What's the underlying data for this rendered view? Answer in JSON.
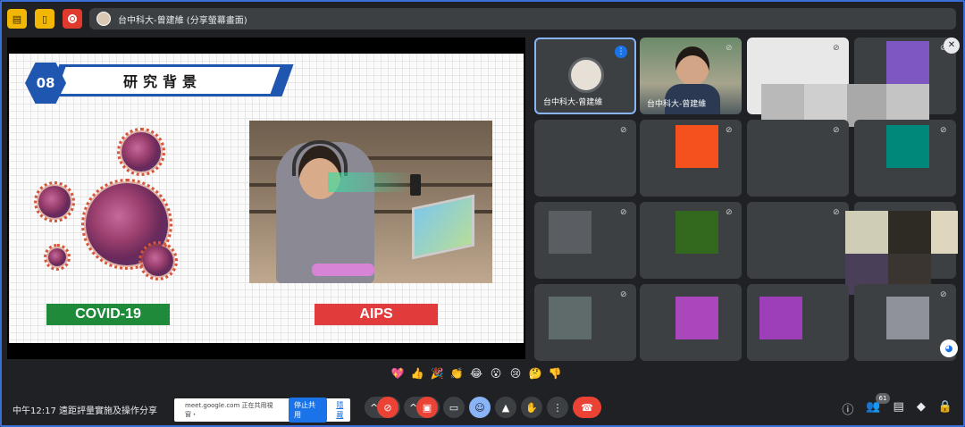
{
  "topbar": {
    "presenter_label": "台中科大-曾建維 (分享螢幕畫面)"
  },
  "slide": {
    "number": "08",
    "title": "研究背景",
    "left_label": "COVID-19",
    "right_label": "AIPS",
    "left_label_color": "#1f8a3a",
    "right_label_color": "#e23b3b"
  },
  "tiles": {
    "self_name": "台中科大-曾建維",
    "camera_name": "台中科大-曾建維"
  },
  "reactions": [
    "💖",
    "👍",
    "🎉",
    "👏",
    "😂",
    "😮",
    "😢",
    "🤔",
    "👎"
  ],
  "bottom": {
    "time": "中午12:17",
    "meeting_title": "遠距評量實施及操作分享",
    "share_notice": "meet.google.com 正在共用視窗・",
    "stop_share": "停止共用",
    "hide": "隱藏",
    "participant_count": "61"
  },
  "colors": {
    "accent": "#1f56b0",
    "end_call": "#ea4335",
    "background": "#202124"
  }
}
